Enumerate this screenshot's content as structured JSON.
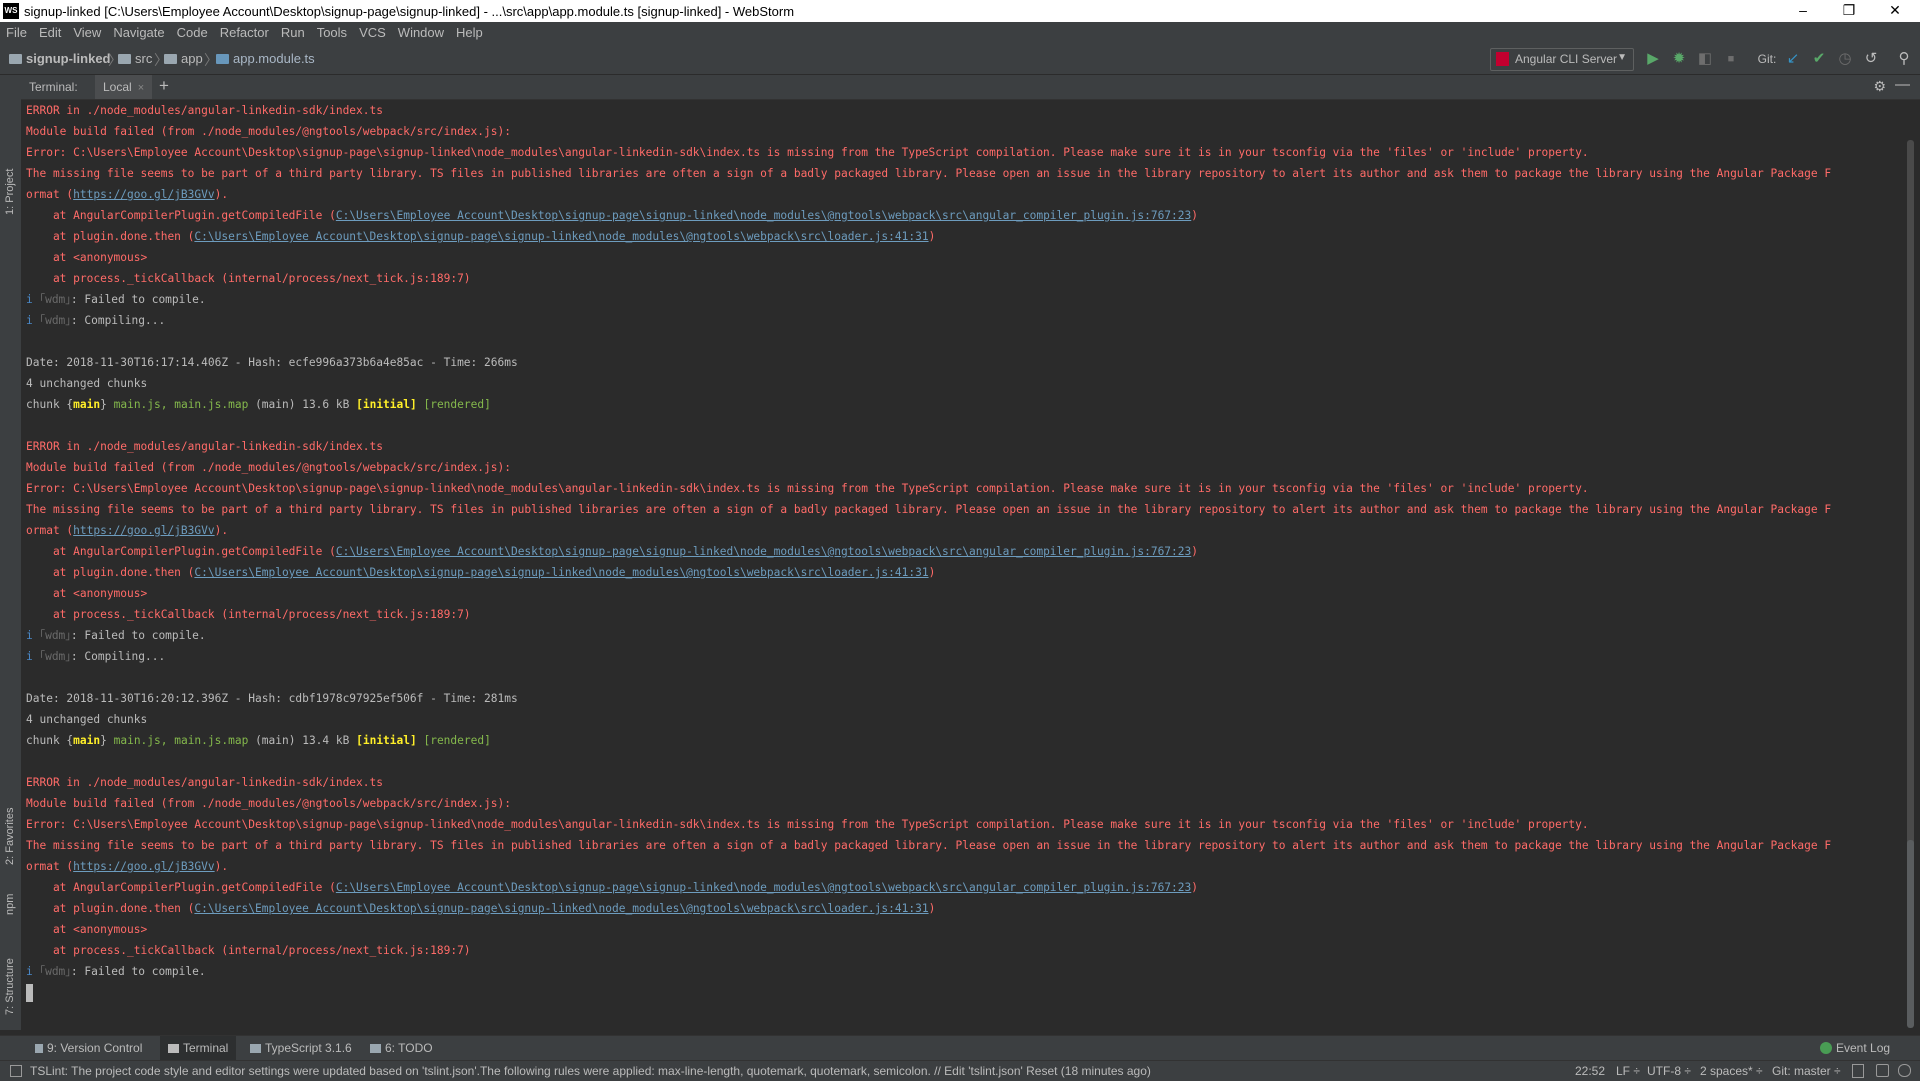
{
  "titlebar": {
    "logo": "WS",
    "title": "signup-linked [C:\\Users\\Employee Account\\Desktop\\signup-page\\signup-linked] - ...\\src\\app\\app.module.ts [signup-linked] - WebStorm",
    "minimize": "–",
    "restore": "❐",
    "close": "✕"
  },
  "menu": [
    "File",
    "Edit",
    "View",
    "Navigate",
    "Code",
    "Refactor",
    "Run",
    "Tools",
    "VCS",
    "Window",
    "Help"
  ],
  "breadcrumb": {
    "project": "signup-linked",
    "src": "src",
    "app": "app",
    "file": "app.module.ts"
  },
  "toolbar": {
    "run_config": "Angular CLI Server",
    "git_label": "Git:",
    "icons": {
      "run": "▶",
      "debug": "✹",
      "coverage": "◧",
      "stop": "■",
      "update": "↙",
      "commit": "✔",
      "history": "◷",
      "revert": "↺",
      "search": "⚲"
    }
  },
  "left_tabs": {
    "project": "1: Project",
    "favorites": "2: Favorites",
    "npm": "npm",
    "structure": "7: Structure"
  },
  "terminal": {
    "label": "Terminal:",
    "tab": "Local",
    "tab_close": "×",
    "new_tab": "+",
    "settings": "⚙",
    "hide": "—",
    "cursor_line": "",
    "lines": [
      {
        "segs": [
          {
            "t": "ERROR in ./node_modules/angular-linkedin-sdk/index.ts",
            "c": "err"
          }
        ]
      },
      {
        "segs": [
          {
            "t": "Module build failed (from ./node_modules/@ngtools/webpack/src/index.js):",
            "c": "err"
          }
        ]
      },
      {
        "segs": [
          {
            "t": "Error: C:\\Users\\Employee Account\\Desktop\\signup-page\\signup-linked\\node_modules\\angular-linkedin-sdk\\index.ts is missing from the TypeScript compilation. Please make sure it is in your tsconfig via the 'files' or 'include' property.",
            "c": "err"
          }
        ]
      },
      {
        "segs": [
          {
            "t": "The missing file seems to be part of a third party library. TS files in published libraries are often a sign of a badly packaged library. Please open an issue in the library repository to alert its author and ask them to package the library using the Angular Package F",
            "c": "err"
          }
        ]
      },
      {
        "segs": [
          {
            "t": "ormat (",
            "c": "err"
          },
          {
            "t": "https://goo.gl/jB3GVv",
            "c": "link"
          },
          {
            "t": ").",
            "c": "err"
          }
        ]
      },
      {
        "segs": [
          {
            "t": "    at AngularCompilerPlugin.getCompiledFile (",
            "c": "err"
          },
          {
            "t": "C:\\Users\\Employee Account\\Desktop\\signup-page\\signup-linked\\node_modules\\@ngtools\\webpack\\src\\angular_compiler_plugin.js:767:23",
            "c": "link"
          },
          {
            "t": ")",
            "c": "err"
          }
        ]
      },
      {
        "segs": [
          {
            "t": "    at plugin.done.then (",
            "c": "err"
          },
          {
            "t": "C:\\Users\\Employee Account\\Desktop\\signup-page\\signup-linked\\node_modules\\@ngtools\\webpack\\src\\loader.js:41:31",
            "c": "link"
          },
          {
            "t": ")",
            "c": "err"
          }
        ]
      },
      {
        "segs": [
          {
            "t": "    at <anonymous>",
            "c": "err"
          }
        ]
      },
      {
        "segs": [
          {
            "t": "    at process._tickCallback (internal/process/next_tick.js:189:7)",
            "c": "err"
          }
        ]
      },
      {
        "segs": [
          {
            "t": "i ",
            "c": "info"
          },
          {
            "t": "｢wdm｣",
            "c": "wdm"
          },
          {
            "t": ": Failed to compile.",
            "c": "plain"
          }
        ]
      },
      {
        "segs": [
          {
            "t": "i ",
            "c": "info"
          },
          {
            "t": "｢wdm｣",
            "c": "wdm"
          },
          {
            "t": ": Compiling...",
            "c": "plain"
          }
        ]
      },
      {
        "segs": []
      },
      {
        "segs": [
          {
            "t": "Date: 2018-11-30T16:17:14.406Z - Hash: ecfe996a373b6a4e85ac - Time: 266ms",
            "c": "plain"
          }
        ]
      },
      {
        "segs": [
          {
            "t": "4 unchanged chunks",
            "c": "plain"
          }
        ]
      },
      {
        "segs": [
          {
            "t": "chunk ",
            "c": "plain"
          },
          {
            "t": "{",
            "c": "plain"
          },
          {
            "t": "main",
            "c": "yb"
          },
          {
            "t": "}",
            "c": "plain"
          },
          {
            "t": " main.js, main.js.map",
            "c": "grn"
          },
          {
            "t": " (main) 13.6 kB ",
            "c": "plain"
          },
          {
            "t": "[initial]",
            "c": "yb"
          },
          {
            "t": " [rendered]",
            "c": "grn"
          }
        ]
      },
      {
        "segs": []
      },
      {
        "segs": [
          {
            "t": "ERROR in ./node_modules/angular-linkedin-sdk/index.ts",
            "c": "err"
          }
        ]
      },
      {
        "segs": [
          {
            "t": "Module build failed (from ./node_modules/@ngtools/webpack/src/index.js):",
            "c": "err"
          }
        ]
      },
      {
        "segs": [
          {
            "t": "Error: C:\\Users\\Employee Account\\Desktop\\signup-page\\signup-linked\\node_modules\\angular-linkedin-sdk\\index.ts is missing from the TypeScript compilation. Please make sure it is in your tsconfig via the 'files' or 'include' property.",
            "c": "err"
          }
        ]
      },
      {
        "segs": [
          {
            "t": "The missing file seems to be part of a third party library. TS files in published libraries are often a sign of a badly packaged library. Please open an issue in the library repository to alert its author and ask them to package the library using the Angular Package F",
            "c": "err"
          }
        ]
      },
      {
        "segs": [
          {
            "t": "ormat (",
            "c": "err"
          },
          {
            "t": "https://goo.gl/jB3GVv",
            "c": "link"
          },
          {
            "t": ").",
            "c": "err"
          }
        ]
      },
      {
        "segs": [
          {
            "t": "    at AngularCompilerPlugin.getCompiledFile (",
            "c": "err"
          },
          {
            "t": "C:\\Users\\Employee Account\\Desktop\\signup-page\\signup-linked\\node_modules\\@ngtools\\webpack\\src\\angular_compiler_plugin.js:767:23",
            "c": "link"
          },
          {
            "t": ")",
            "c": "err"
          }
        ]
      },
      {
        "segs": [
          {
            "t": "    at plugin.done.then (",
            "c": "err"
          },
          {
            "t": "C:\\Users\\Employee Account\\Desktop\\signup-page\\signup-linked\\node_modules\\@ngtools\\webpack\\src\\loader.js:41:31",
            "c": "link"
          },
          {
            "t": ")",
            "c": "err"
          }
        ]
      },
      {
        "segs": [
          {
            "t": "    at <anonymous>",
            "c": "err"
          }
        ]
      },
      {
        "segs": [
          {
            "t": "    at process._tickCallback (internal/process/next_tick.js:189:7)",
            "c": "err"
          }
        ]
      },
      {
        "segs": [
          {
            "t": "i ",
            "c": "info"
          },
          {
            "t": "｢wdm｣",
            "c": "wdm"
          },
          {
            "t": ": Failed to compile.",
            "c": "plain"
          }
        ]
      },
      {
        "segs": [
          {
            "t": "i ",
            "c": "info"
          },
          {
            "t": "｢wdm｣",
            "c": "wdm"
          },
          {
            "t": ": Compiling...",
            "c": "plain"
          }
        ]
      },
      {
        "segs": []
      },
      {
        "segs": [
          {
            "t": "Date: 2018-11-30T16:20:12.396Z - Hash: cdbf1978c97925ef506f - Time: 281ms",
            "c": "plain"
          }
        ]
      },
      {
        "segs": [
          {
            "t": "4 unchanged chunks",
            "c": "plain"
          }
        ]
      },
      {
        "segs": [
          {
            "t": "chunk ",
            "c": "plain"
          },
          {
            "t": "{",
            "c": "plain"
          },
          {
            "t": "main",
            "c": "yb"
          },
          {
            "t": "}",
            "c": "plain"
          },
          {
            "t": " main.js, main.js.map",
            "c": "grn"
          },
          {
            "t": " (main) 13.4 kB ",
            "c": "plain"
          },
          {
            "t": "[initial]",
            "c": "yb"
          },
          {
            "t": " [rendered]",
            "c": "grn"
          }
        ]
      },
      {
        "segs": []
      },
      {
        "segs": [
          {
            "t": "ERROR in ./node_modules/angular-linkedin-sdk/index.ts",
            "c": "err"
          }
        ]
      },
      {
        "segs": [
          {
            "t": "Module build failed (from ./node_modules/@ngtools/webpack/src/index.js):",
            "c": "err"
          }
        ]
      },
      {
        "segs": [
          {
            "t": "Error: C:\\Users\\Employee Account\\Desktop\\signup-page\\signup-linked\\node_modules\\angular-linkedin-sdk\\index.ts is missing from the TypeScript compilation. Please make sure it is in your tsconfig via the 'files' or 'include' property.",
            "c": "err"
          }
        ]
      },
      {
        "segs": [
          {
            "t": "The missing file seems to be part of a third party library. TS files in published libraries are often a sign of a badly packaged library. Please open an issue in the library repository to alert its author and ask them to package the library using the Angular Package F",
            "c": "err"
          }
        ]
      },
      {
        "segs": [
          {
            "t": "ormat (",
            "c": "err"
          },
          {
            "t": "https://goo.gl/jB3GVv",
            "c": "link"
          },
          {
            "t": ").",
            "c": "err"
          }
        ]
      },
      {
        "segs": [
          {
            "t": "    at AngularCompilerPlugin.getCompiledFile (",
            "c": "err"
          },
          {
            "t": "C:\\Users\\Employee Account\\Desktop\\signup-page\\signup-linked\\node_modules\\@ngtools\\webpack\\src\\angular_compiler_plugin.js:767:23",
            "c": "link"
          },
          {
            "t": ")",
            "c": "err"
          }
        ]
      },
      {
        "segs": [
          {
            "t": "    at plugin.done.then (",
            "c": "err"
          },
          {
            "t": "C:\\Users\\Employee Account\\Desktop\\signup-page\\signup-linked\\node_modules\\@ngtools\\webpack\\src\\loader.js:41:31",
            "c": "link"
          },
          {
            "t": ")",
            "c": "err"
          }
        ]
      },
      {
        "segs": [
          {
            "t": "    at <anonymous>",
            "c": "err"
          }
        ]
      },
      {
        "segs": [
          {
            "t": "    at process._tickCallback (internal/process/next_tick.js:189:7)",
            "c": "err"
          }
        ]
      },
      {
        "segs": [
          {
            "t": "i ",
            "c": "info"
          },
          {
            "t": "｢wdm｣",
            "c": "wdm"
          },
          {
            "t": ": Failed to compile.",
            "c": "plain"
          }
        ]
      }
    ]
  },
  "toolwindows": {
    "version_control": "9: Version Control",
    "terminal": "Terminal",
    "typescript": "TypeScript 3.1.6",
    "todo": "6: TODO",
    "event_log": "Event Log"
  },
  "status": {
    "message": "TSLint: The project code style and editor settings were updated based on 'tslint.json'.The following rules were applied: max-line-length, quotemark, quotemark, semicolon. // Edit 'tslint.json' Reset (18 minutes ago)",
    "position": "22:52",
    "line_sep": "LF ÷",
    "encoding": "UTF-8 ÷",
    "indent": "2 spaces* ÷",
    "git": "Git: master ÷"
  }
}
